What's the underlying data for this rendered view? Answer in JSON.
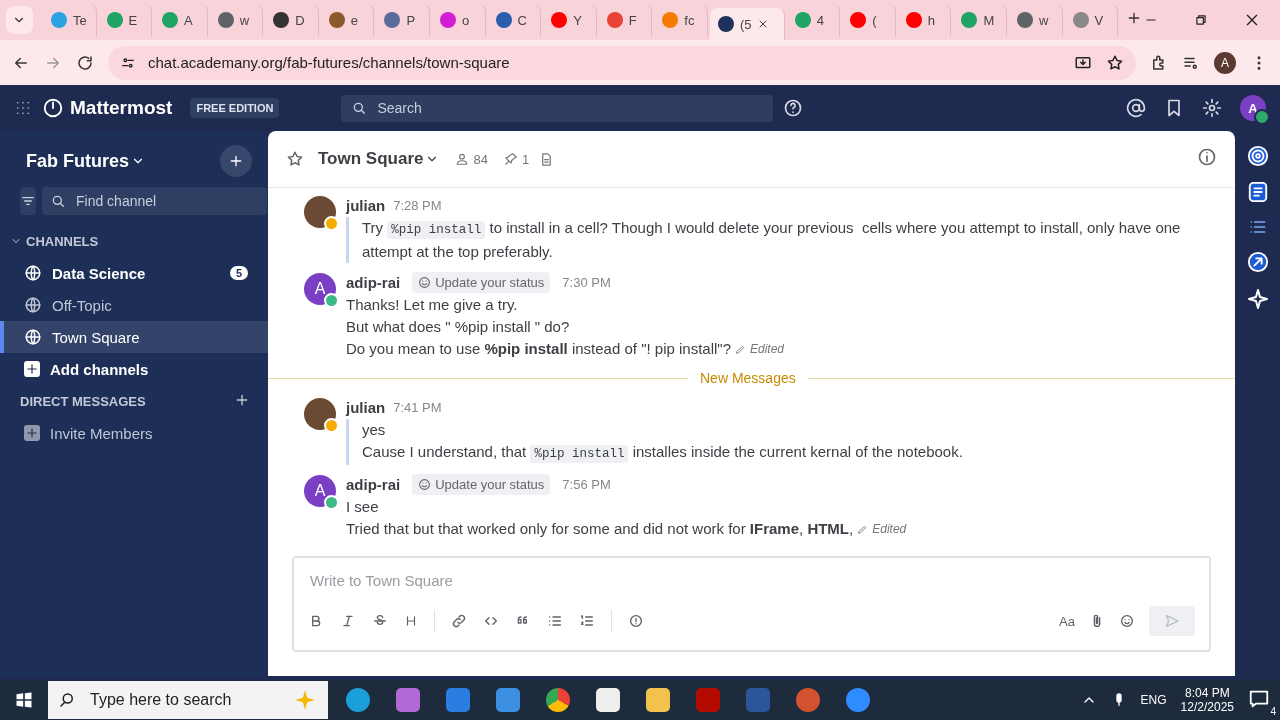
{
  "browser": {
    "tabs": [
      {
        "label": "Te",
        "color": "#2aa3e0",
        "selected": false
      },
      {
        "label": "E",
        "color": "#1fa463",
        "selected": false
      },
      {
        "label": "A",
        "color": "#1fa463",
        "selected": false
      },
      {
        "label": "w",
        "color": "#5f6368",
        "selected": false
      },
      {
        "label": "D",
        "color": "#333333",
        "selected": false
      },
      {
        "label": "e",
        "color": "#8b5a2b",
        "selected": false
      },
      {
        "label": "P",
        "color": "#5a6b9a",
        "selected": false
      },
      {
        "label": "o",
        "color": "#d01fd0",
        "selected": false
      },
      {
        "label": "C",
        "color": "#2b5fad",
        "selected": false
      },
      {
        "label": "Y",
        "color": "#ff0000",
        "selected": false
      },
      {
        "label": "F",
        "color": "#ea4335",
        "selected": false
      },
      {
        "label": "fc",
        "color": "#f57c00",
        "selected": false
      },
      {
        "label": "(5",
        "color": "#1e325c",
        "selected": true
      },
      {
        "label": "4",
        "color": "#1fa463",
        "selected": false
      },
      {
        "label": "(",
        "color": "#ff0000",
        "selected": false
      },
      {
        "label": "h",
        "color": "#ff0000",
        "selected": false
      },
      {
        "label": "M",
        "color": "#1fa463",
        "selected": false
      },
      {
        "label": "w",
        "color": "#5f6368",
        "selected": false
      },
      {
        "label": "V",
        "color": "#888888",
        "selected": false
      }
    ],
    "address": "chat.academany.org/fab-futures/channels/town-square",
    "profile": "A"
  },
  "header": {
    "product": "Mattermost",
    "edition": "FREE EDITION",
    "search_placeholder": "Search",
    "avatar": "A"
  },
  "sidebar": {
    "team": "Fab Futures",
    "find_placeholder": "Find channel",
    "channels_heading": "CHANNELS",
    "channels": [
      {
        "name": "Data Science",
        "unread": true,
        "badge": "5",
        "selected": false
      },
      {
        "name": "Off-Topic",
        "unread": false,
        "selected": false
      },
      {
        "name": "Town Square",
        "unread": false,
        "selected": true
      }
    ],
    "add_channels": "Add channels",
    "dm_heading": "DIRECT MESSAGES",
    "invite": "Invite Members"
  },
  "channel": {
    "name": "Town Square",
    "members": "84",
    "pinned": "1"
  },
  "timeline": [
    {
      "kind": "post",
      "author": "julian",
      "photo": true,
      "online": false,
      "time": "7:28 PM",
      "threaded": true,
      "lines": [
        [
          {
            "kind": "text",
            "text": "Try "
          },
          {
            "kind": "code",
            "text": "%pip install"
          },
          {
            "kind": "text",
            "text": " to install in a cell? Though I would delete your previous  cells where you attempt to install, only have one attempt at the top preferably."
          }
        ]
      ]
    },
    {
      "kind": "post",
      "author": "adip-rai",
      "photo": false,
      "avatar_letter": "A",
      "online": true,
      "status_prompt": "Update your status",
      "time": "7:30 PM",
      "threaded": false,
      "lines": [
        [
          {
            "kind": "text",
            "text": "Thanks! Let me give a try."
          }
        ],
        [
          {
            "kind": "text",
            "text": "But what does \" %pip install \" do?"
          }
        ],
        [
          {
            "kind": "text",
            "text": "Do you mean to use **%pip install** instead of \"! pip install\"?"
          }
        ]
      ],
      "edited": "Edited"
    },
    {
      "kind": "separator",
      "text": "New Messages"
    },
    {
      "kind": "post",
      "author": "julian",
      "photo": true,
      "online": false,
      "time": "7:41 PM",
      "threaded": true,
      "lines": [
        [
          {
            "kind": "text",
            "text": "yes"
          }
        ],
        [
          {
            "kind": "text",
            "text": "Cause I understand, that "
          },
          {
            "kind": "code",
            "text": "%pip install"
          },
          {
            "kind": "text",
            "text": " installes inside the current kernal of the notebook."
          }
        ]
      ]
    },
    {
      "kind": "post",
      "author": "adip-rai",
      "photo": false,
      "avatar_letter": "A",
      "online": true,
      "status_prompt": "Update your status",
      "time": "7:56 PM",
      "threaded": false,
      "lines": [
        [
          {
            "kind": "text",
            "text": "I see"
          }
        ],
        [
          {
            "kind": "text",
            "text": "Tried that but that worked only for some and did not work for **IFrame**, **HTML**,"
          }
        ]
      ],
      "edited": "Edited"
    }
  ],
  "composer": {
    "placeholder": "Write to Town Square",
    "format_label": "Aa"
  },
  "taskbar": {
    "search_placeholder": "Type here to search",
    "language": "ENG",
    "time": "8:04 PM",
    "date": "12/2/2025",
    "notifications": "4"
  }
}
